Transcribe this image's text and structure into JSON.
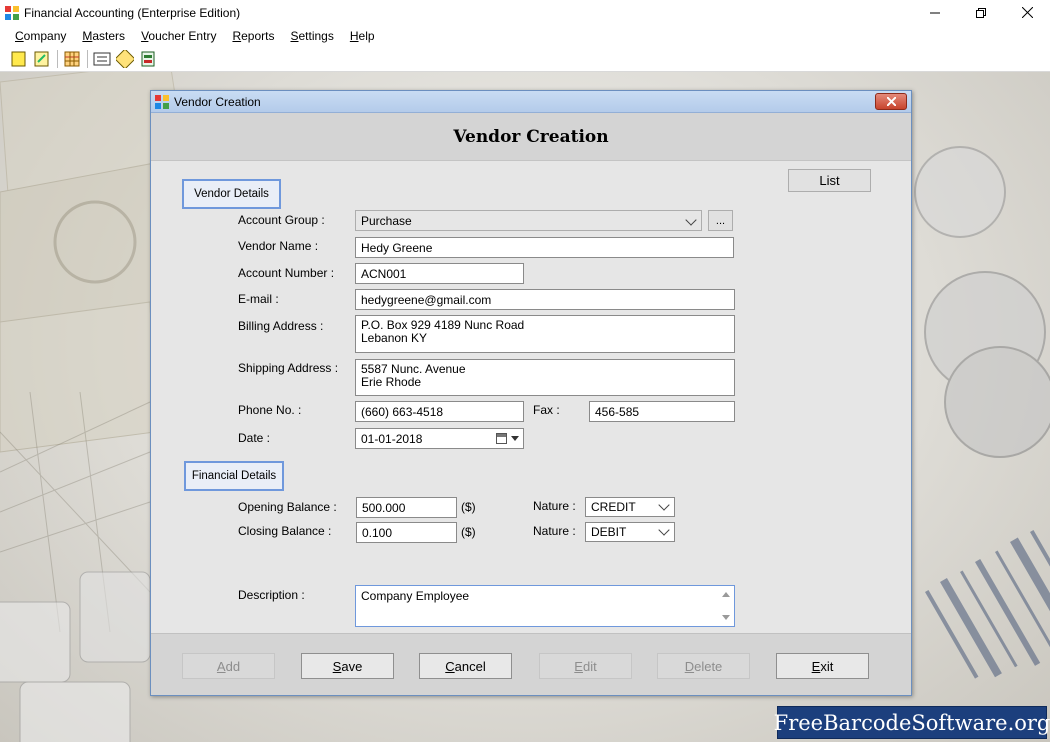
{
  "window": {
    "title": "Financial Accounting (Enterprise Edition)"
  },
  "menubar": {
    "items": [
      "Company",
      "Masters",
      "Voucher Entry",
      "Reports",
      "Settings",
      "Help"
    ]
  },
  "toolbar": {
    "icons": [
      "new-company-icon",
      "open-company-icon",
      "grid-icon",
      "ledger-icon",
      "edit-icon",
      "exit-icon"
    ]
  },
  "watermark": {
    "text": "FreeBarcodeSoftware.org"
  },
  "dialog": {
    "title": "Vendor Creation",
    "header": "Vendor Creation",
    "list_label": "List",
    "vendor_section": "Vendor Details",
    "financial_section": "Financial Details",
    "labels": {
      "account_group": "Account Group :",
      "vendor_name": "Vendor Name :",
      "account_number": "Account Number :",
      "email": "E-mail :",
      "billing_address": "Billing Address :",
      "shipping_address": "Shipping Address :",
      "phone": "Phone No. :",
      "fax": "Fax :",
      "date": "Date :",
      "opening_balance": "Opening Balance :",
      "closing_balance": "Closing Balance :",
      "nature": "Nature :",
      "currency": "($)",
      "description": "Description :"
    },
    "values": {
      "account_group": "Purchase",
      "browse": "...",
      "vendor_name": "Hedy Greene",
      "account_number": "ACN001",
      "email": "hedygreene@gmail.com",
      "billing_address": " P.O. Box 929 4189 Nunc Road\nLebanon KY",
      "shipping_address": "5587 Nunc. Avenue\nErie Rhode",
      "phone": "(660) 663-4518",
      "fax": "456-585",
      "date": "01-01-2018",
      "opening_balance": "500.000",
      "opening_nature": "CREDIT",
      "closing_balance": "0.100",
      "closing_nature": "DEBIT",
      "description": "Company Employee"
    },
    "buttons": {
      "add": {
        "first": "A",
        "rest": "dd"
      },
      "save": {
        "first": "S",
        "rest": "ave"
      },
      "cancel": {
        "first": "C",
        "rest": "ancel"
      },
      "edit": {
        "first": "E",
        "rest": "dit"
      },
      "delete": {
        "first": "D",
        "rest": "elete"
      },
      "exit": {
        "first": "E",
        "rest": "xit"
      }
    }
  },
  "colors": {
    "section_border": "#6f98dc",
    "close_button": "#c7442d",
    "watermark_bg": "#1c3f7d"
  }
}
